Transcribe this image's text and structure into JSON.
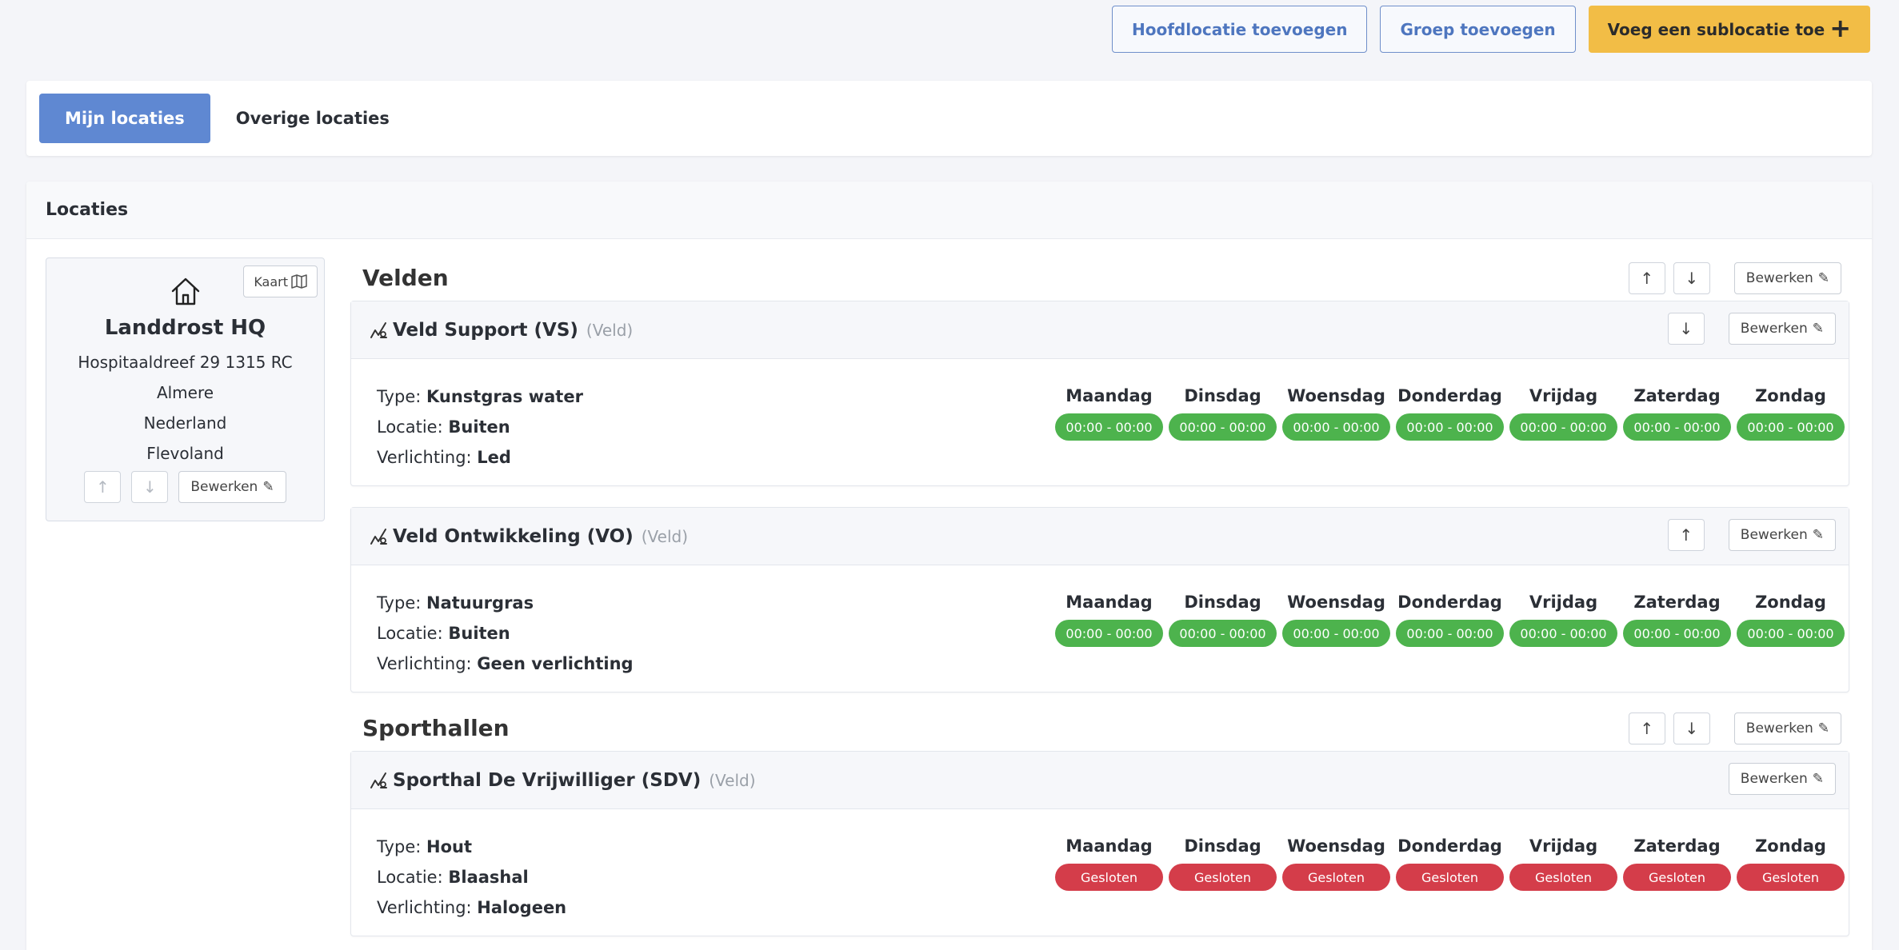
{
  "topbar": {
    "add_main_location": "Hoofdlocatie toevoegen",
    "add_group": "Groep toevoegen",
    "add_sublocation": "Voeg een sublocatie toe",
    "add_sublocation_icon": "+"
  },
  "tabs": {
    "mine": "Mijn locaties",
    "other": "Overige locaties"
  },
  "section_title": "Locaties",
  "location": {
    "map_button": "Kaart",
    "name": "Landdrost HQ",
    "address": "Hospitaaldreef 29 1315 RC",
    "city": "Almere",
    "country": "Nederland",
    "province": "Flevoland",
    "edit": "Bewerken"
  },
  "labels": {
    "type": "Type:",
    "location": "Locatie:",
    "lighting": "Verlichting:",
    "edit": "Bewerken"
  },
  "days": [
    "Maandag",
    "Dinsdag",
    "Woensdag",
    "Donderdag",
    "Vrijdag",
    "Zaterdag",
    "Zondag"
  ],
  "groups": [
    {
      "title": "Velden",
      "sublocations": [
        {
          "name": "Veld Support (VS)",
          "kind": "(Veld)",
          "type": "Kunstgras water",
          "location": "Buiten",
          "lighting": "Led",
          "hours": [
            "00:00 - 00:00",
            "00:00 - 00:00",
            "00:00 - 00:00",
            "00:00 - 00:00",
            "00:00 - 00:00",
            "00:00 - 00:00",
            "00:00 - 00:00"
          ]
        },
        {
          "name": "Veld Ontwikkeling (VO)",
          "kind": "(Veld)",
          "type": "Natuurgras",
          "location": "Buiten",
          "lighting": "Geen verlichting",
          "hours": [
            "00:00 - 00:00",
            "00:00 - 00:00",
            "00:00 - 00:00",
            "00:00 - 00:00",
            "00:00 - 00:00",
            "00:00 - 00:00",
            "00:00 - 00:00"
          ]
        }
      ]
    },
    {
      "title": "Sporthallen",
      "sublocations": [
        {
          "name": "Sporthal De Vrijwilliger (SDV)",
          "kind": "(Veld)",
          "type": "Hout",
          "location": "Blaashal",
          "lighting": "Halogeen",
          "hours": [
            "Gesloten",
            "Gesloten",
            "Gesloten",
            "Gesloten",
            "Gesloten",
            "Gesloten",
            "Gesloten"
          ]
        }
      ]
    }
  ],
  "colors": {
    "primary": "#5f88d2",
    "accent_yellow": "#f2bd46",
    "open": "#4db34d",
    "closed": "#d43d4a"
  },
  "icons": {
    "home": "home-icon",
    "map": "map-icon",
    "pencil": "pencil-icon",
    "arrow_up": "arrow-up-icon",
    "arrow_down": "arrow-down-icon",
    "sublocation": "sublocation-icon"
  }
}
